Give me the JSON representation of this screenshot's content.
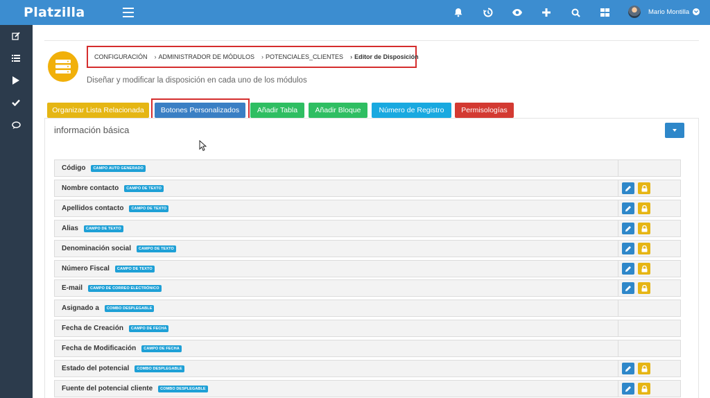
{
  "app": {
    "name": "Platzilla"
  },
  "user": {
    "name": "Mario Montilla"
  },
  "breadcrumb": [
    "CONFIGURACIÓN",
    "ADMINISTRADOR DE MÓDULOS",
    "POTENCIALES_CLIENTES",
    "Editor de Disposición"
  ],
  "page": {
    "subtitle": "Diseñar y modificar la disposición en cada uno de los módulos"
  },
  "toolbar": {
    "organize_label": "Organizar Lista Relacionada",
    "custom_buttons_label": "Botones Personalizados",
    "add_table_label": "Añadir Tabla",
    "add_block_label": "Añadir Bloque",
    "record_number_label": "Número de Registro",
    "permissions_label": "Permisologías"
  },
  "panel": {
    "title": "información básica"
  },
  "fields": [
    {
      "label": "Código",
      "type": "CAMPO AUTO GENERADO",
      "editable": false
    },
    {
      "label": "Nombre contacto",
      "type": "CAMPO DE TEXTO",
      "editable": true
    },
    {
      "label": "Apellidos contacto",
      "type": "CAMPO DE TEXTO",
      "editable": true
    },
    {
      "label": "Alias",
      "type": "CAMPO DE TEXTO",
      "editable": true
    },
    {
      "label": "Denominación social",
      "type": "CAMPO DE TEXTO",
      "editable": true
    },
    {
      "label": "Número Fiscal",
      "type": "CAMPO DE TEXTO",
      "editable": true
    },
    {
      "label": "E-mail",
      "type": "CAMPO DE CORREO ELECTRÓNICO",
      "editable": true
    },
    {
      "label": "Asignado a",
      "type": "COMBO DESPLEGABLE",
      "editable": false
    },
    {
      "label": "Fecha de Creación",
      "type": "CAMPO DE FECHA",
      "editable": false
    },
    {
      "label": "Fecha de Modificación",
      "type": "CAMPO DE FECHA",
      "editable": false
    },
    {
      "label": "Estado del potencial",
      "type": "COMBO DESPLEGABLE",
      "editable": true
    },
    {
      "label": "Fuente del potencial cliente",
      "type": "COMBO DESPLEGABLE",
      "editable": true
    }
  ],
  "colors": {
    "topbar": "#3c8dd0",
    "sidebar": "#2c3b4c",
    "highlight": "#d52d2d"
  }
}
